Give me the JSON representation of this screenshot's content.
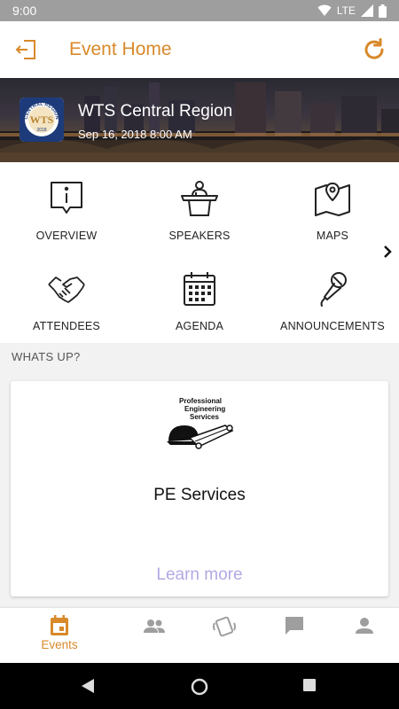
{
  "status": {
    "time": "9:00",
    "network": "LTE"
  },
  "header": {
    "title": "Event Home"
  },
  "event": {
    "name": "WTS Central Region",
    "date": "Sep 16, 2018 8:00 AM",
    "logo_text": "CENTRAL REGION",
    "logo_mark": "WTS",
    "logo_year": "2018"
  },
  "menu": [
    {
      "label": "OVERVIEW",
      "icon": "info-icon"
    },
    {
      "label": "SPEAKERS",
      "icon": "podium-icon"
    },
    {
      "label": "MAPS",
      "icon": "map-icon"
    },
    {
      "label": "ATTENDEES",
      "icon": "handshake-icon"
    },
    {
      "label": "AGENDA",
      "icon": "calendar-icon"
    },
    {
      "label": "ANNOUNCEMENTS",
      "icon": "microphone-icon"
    }
  ],
  "whats_up": {
    "section_title": "WHATS UP?",
    "sponsor_logo_text": [
      "Professional",
      "Engineering",
      "Services"
    ],
    "sponsor_name": "PE Services",
    "learn_more": "Learn more"
  },
  "bottom_nav": [
    {
      "label": "Events",
      "icon": "calendar-icon",
      "active": true
    },
    {
      "label": "",
      "icon": "people-icon"
    },
    {
      "label": "",
      "icon": "badge-scan-icon"
    },
    {
      "label": "",
      "icon": "chat-icon"
    },
    {
      "label": "",
      "icon": "person-icon"
    }
  ],
  "colors": {
    "accent": "#d8892a",
    "link": "#b3a9e3",
    "inactive_icon": "#9e9e9e"
  }
}
